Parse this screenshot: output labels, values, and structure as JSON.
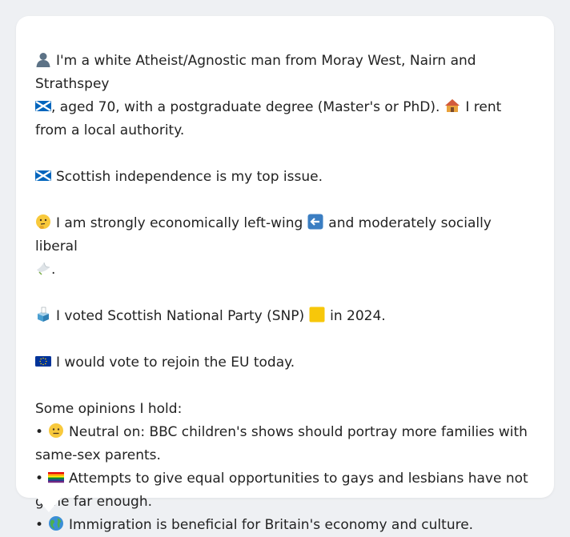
{
  "profile": {
    "intro_part1": "I'm a white Atheist/Agnostic man from Moray West, Nairn and Strathspey",
    "intro_part2": ", aged 70, with a postgraduate degree (Master's or PhD).",
    "intro_part3": "I rent from a local authority.",
    "top_issue": "Scottish independence is my top issue.",
    "politics_part1": "I am strongly economically left-wing",
    "politics_part2": "and moderately socially liberal",
    "politics_part3": ".",
    "vote_part1": "I voted Scottish National Party (SNP)",
    "vote_part2": "in 2024.",
    "eu": "I would vote to rejoin the EU today.",
    "opinions_heading": "Some opinions I hold:",
    "bullet_char": "•",
    "opinions": [
      {
        "icon": "neutral-face-icon",
        "text": "Neutral on: BBC children's shows should portray more families with same-sex parents."
      },
      {
        "icon": "rainbow-flag-icon",
        "text": "Attempts to give equal opportunities to gays and lesbians have not gone far enough."
      },
      {
        "icon": "globe-icon",
        "text": "Immigration is beneficial for Britain's economy and culture."
      }
    ]
  },
  "icons": {
    "intro": "person-silhouette-icon",
    "region_flag": "scotland-flag-icon",
    "housing": "house-icon",
    "issue_flag": "scotland-flag-icon",
    "thinking": "thinking-face-icon",
    "left_arrow": "left-arrow-icon",
    "dove": "dove-icon",
    "ballot": "ballot-box-icon",
    "party_color": "yellow-square-icon",
    "eu_flag": "eu-flag-icon"
  },
  "colors": {
    "background": "#eef0f3",
    "card": "#ffffff",
    "text": "#222222",
    "party_yellow": "#f7c70a",
    "scotland_blue": "#0065bd",
    "eu_blue": "#003399"
  }
}
